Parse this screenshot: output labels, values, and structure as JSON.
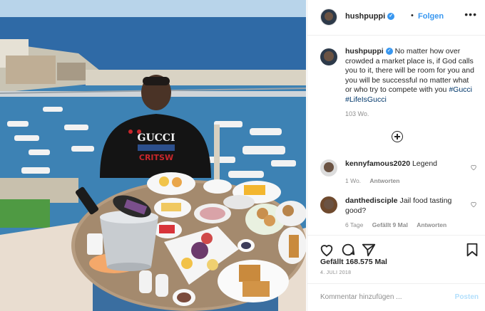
{
  "post": {
    "username": "hushpuppi",
    "follow_label": "Folgen",
    "separator": "•",
    "more_label": "•••"
  },
  "caption": {
    "username": "hushpuppi",
    "text": "No matter how over crowded a market place is, if God calls you to it, there will be room for you and you will be successful no matter what or who try to compete with you",
    "hashtags": "#Gucci #LifeIsGucci",
    "time": "103 Wo."
  },
  "comments": [
    {
      "username": "kennyfamous2020",
      "text": "Legend",
      "time": "1 Wo.",
      "likes": "",
      "reply": "Antworten"
    },
    {
      "username": "danthedisciple",
      "text": "Jail food tasting good?",
      "time": "6 Tage",
      "likes": "Gefällt 9 Mal",
      "reply": "Antworten"
    }
  ],
  "likes_label": "Gefällt 168.575 Mal",
  "date": "4. JULI 2018",
  "add_comment": {
    "placeholder": "Kommentar hinzufügen ...",
    "post_label": "Posten"
  },
  "photo": {
    "sweater_text": "GUCCI",
    "icons": [
      "heart-icon",
      "comment-icon",
      "share-icon",
      "bookmark-icon",
      "plus-circle-icon",
      "more-icon"
    ]
  }
}
